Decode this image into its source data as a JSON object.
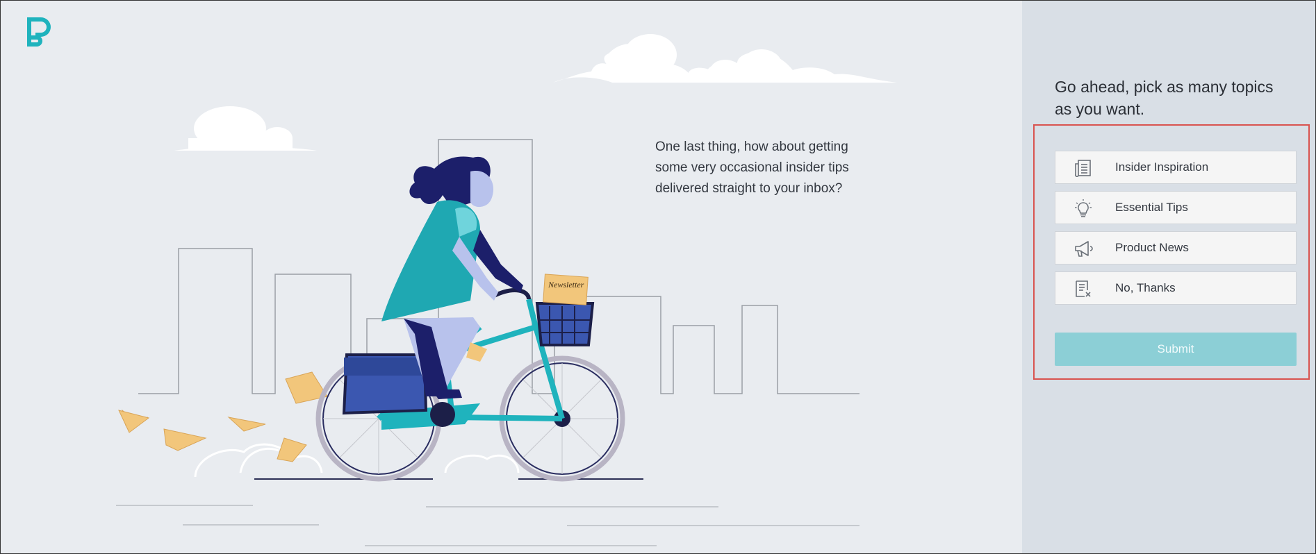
{
  "intro": {
    "line1": "One last thing, how about getting",
    "line2": "some very occasional insider tips",
    "line3": "delivered straight to your inbox?"
  },
  "panel": {
    "heading_line1": "Go ahead, pick as many topics",
    "heading_line2": "as you want.",
    "topics": [
      {
        "label": "Insider Inspiration",
        "icon": "newspaper-icon"
      },
      {
        "label": "Essential Tips",
        "icon": "lightbulb-icon"
      },
      {
        "label": "Product News",
        "icon": "megaphone-icon"
      },
      {
        "label": "No, Thanks",
        "icon": "document-x-icon"
      }
    ],
    "submit_label": "Submit"
  },
  "illustration": {
    "newspaper_text": "Newsletter"
  },
  "colors": {
    "brand_teal": "#1fb3bd",
    "submit_bg": "#8ccfd6",
    "panel_bg": "#d9dfe6",
    "page_bg": "#e9ecf0",
    "highlight_border": "#d9534f"
  }
}
